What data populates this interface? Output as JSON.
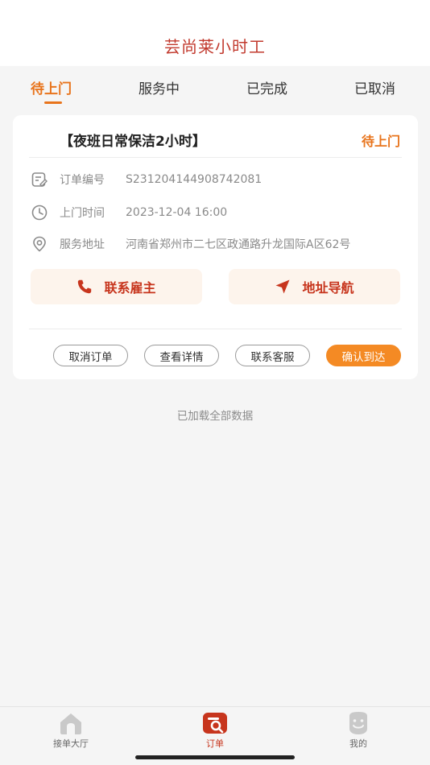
{
  "app": {
    "title": "芸尚莱小时工"
  },
  "tabs": [
    {
      "label": "待上门",
      "active": true
    },
    {
      "label": "服务中",
      "active": false
    },
    {
      "label": "已完成",
      "active": false
    },
    {
      "label": "已取消",
      "active": false
    }
  ],
  "order": {
    "title": "【夜班日常保洁2小时】",
    "status": "待上门",
    "fields": [
      {
        "label": "订单编号",
        "value": "S231204144908742081",
        "icon": "document-edit-icon"
      },
      {
        "label": "上门时间",
        "value": "2023-12-04 16:00",
        "icon": "clock-icon"
      },
      {
        "label": "服务地址",
        "value": "河南省郑州市二七区政通路升龙国际A区62号",
        "icon": "location-pin-icon"
      }
    ],
    "actions": {
      "contact_employer": "联系雇主",
      "navigate": "地址导航"
    },
    "buttons": {
      "cancel": "取消订单",
      "details": "查看详情",
      "support": "联系客服",
      "confirm": "确认到达"
    }
  },
  "list_footer": "已加载全部数据",
  "bottom_nav": [
    {
      "label": "接单大厅",
      "icon": "home-icon",
      "active": false
    },
    {
      "label": "订单",
      "icon": "order-icon",
      "active": true
    },
    {
      "label": "我的",
      "icon": "profile-icon",
      "active": false
    }
  ],
  "colors": {
    "accent": "#e8741c",
    "brand_red": "#c23a2e",
    "confirm_button": "#f48a24",
    "action_bg": "#fdf4ec"
  }
}
